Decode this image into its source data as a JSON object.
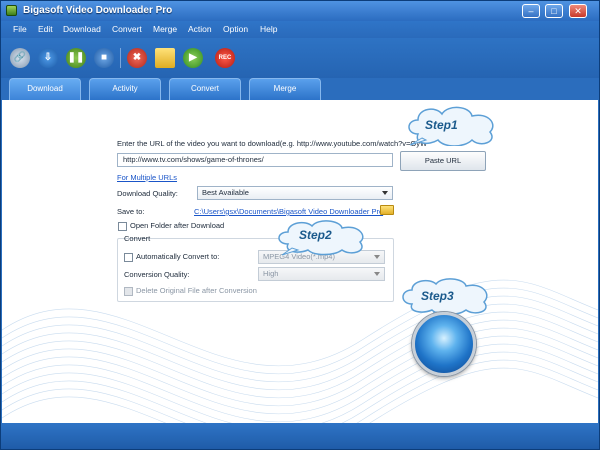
{
  "window": {
    "title": "Bigasoft Video Downloader Pro"
  },
  "menu": [
    "File",
    "Edit",
    "Download",
    "Convert",
    "Merge",
    "Action",
    "Option",
    "Help"
  ],
  "toolbar": {
    "icons": [
      "add-url-icon",
      "download-icon",
      "pause-icon",
      "stop-icon",
      "delete-icon",
      "open-folder-icon",
      "play-icon",
      "record-icon"
    ],
    "rec_label": "REC"
  },
  "tabs": [
    "Download",
    "Activity",
    "Convert",
    "Merge"
  ],
  "active_tab": "Download",
  "download": {
    "url_prompt": "Enter the URL of the video you want to download(e.g. http://www.youtube.com/watch?v=OyW",
    "url_value": "http://www.tv.com/shows/game-of-thrones/",
    "paste_button": "Paste URL",
    "multiple_urls_link": "For Multiple URLs",
    "quality_label": "Download Quality:",
    "quality_value": "Best Available",
    "save_to_label": "Save to:",
    "save_path": "C:\\Users\\gsx\\Documents\\Bigasoft Video Downloader Pro",
    "open_folder_label": "Open Folder after Download"
  },
  "convert_group": {
    "title": "Convert",
    "auto_convert_label": "Automatically Convert to:",
    "format_value": "MPEG4 Video(*.mp4)",
    "conv_quality_label": "Conversion Quality:",
    "conv_quality_value": "High",
    "delete_original_label": "Delete Original File after Conversion"
  },
  "callouts": [
    "Step1",
    "Step2",
    "Step3"
  ],
  "colors": {
    "accent": "#2b6dbd",
    "link": "#1a55c8",
    "callout_text": "#1b5a8c",
    "close": "#c8392a"
  }
}
